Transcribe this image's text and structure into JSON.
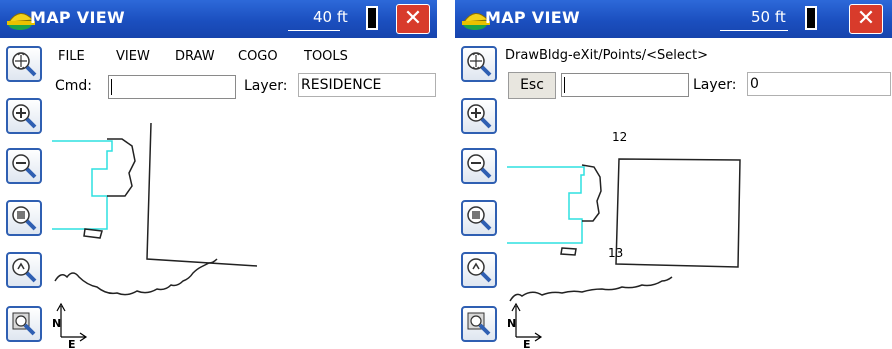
{
  "left": {
    "title": "MAP VIEW",
    "scale": "40 ft",
    "close_label": "✕",
    "menu": {
      "file": "FILE",
      "view": "VIEW",
      "draw": "DRAW",
      "cogo": "COGO",
      "tools": "TOOLS"
    },
    "cmd_label": "Cmd:",
    "cmd_value": "",
    "layer_label": "Layer:",
    "layer_value": "RESIDENCE",
    "north_label": "N",
    "east_label": "E"
  },
  "right": {
    "title": "MAP VIEW",
    "scale": "50 ft",
    "close_label": "✕",
    "prompt": "DrawBldg-eXit/Points/<Select>",
    "esc_label": "Esc",
    "cmd_value": "",
    "layer_label": "Layer:",
    "layer_value": "0",
    "points": [
      "12",
      "13"
    ],
    "north_label": "N",
    "east_label": "E"
  },
  "toolbar_icons": [
    "zoom-extents-icon",
    "zoom-in-icon",
    "zoom-out-icon",
    "zoom-window-icon",
    "zoom-previous-icon",
    "pan-icon"
  ],
  "colors": {
    "titlebar": "#1b4fbf",
    "close": "#d83b2b",
    "linework_cyan": "#2fe0e0",
    "button_border": "#2f5fb2"
  }
}
